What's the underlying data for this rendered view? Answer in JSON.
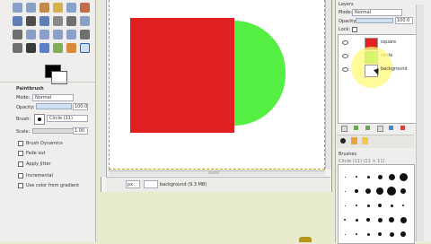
{
  "layers_panel": {
    "title": "Layers",
    "mode_label": "Mode:",
    "mode_value": "Normal",
    "opacity_label": "Opacity:",
    "opacity_value": "100.0",
    "lock_label": "Lock:",
    "items": [
      {
        "name": "square",
        "thumb_color": "#e12121",
        "selected": false
      },
      {
        "name": "circle",
        "thumb_color": "#55ef44",
        "selected": false
      },
      {
        "name": "background",
        "thumb_color": "#ffffff",
        "selected": true
      }
    ]
  },
  "tool_options": {
    "title": "Paintbrush",
    "mode_label": "Mode:",
    "mode_value": "Normal",
    "opacity_label": "Opacity:",
    "opacity_value": "100.0",
    "brush_label": "Brush:",
    "brush_value": "Circle (11)",
    "scale_label": "Scale:",
    "scale_value": "1.00",
    "options": [
      {
        "label": "Brush Dynamics",
        "checked": false
      },
      {
        "label": "Fade out",
        "checked": false
      },
      {
        "label": "Apply Jitter",
        "checked": false
      },
      {
        "label": "Incremental",
        "checked": false
      },
      {
        "label": "Use color from gradient",
        "checked": false
      }
    ]
  },
  "canvas_status": {
    "unit": "px",
    "layer_text": "background (9.3 MB)"
  },
  "brushes_panel": {
    "title": "Brushes",
    "subtitle": "Circle (11) (11 × 11)"
  },
  "colors": {
    "square": "#e12121",
    "circle": "#55ef44",
    "foreground": "#000000",
    "background": "#ffffff",
    "highlight": "#fff878"
  }
}
